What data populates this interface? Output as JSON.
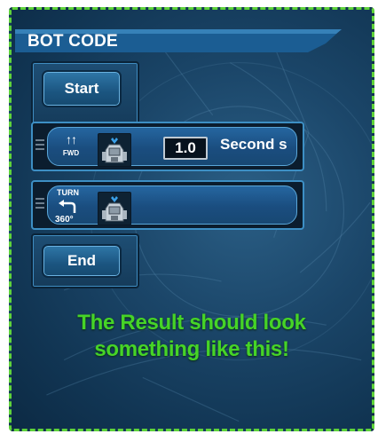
{
  "panel": {
    "title": "BOT CODE"
  },
  "blocks": {
    "start_label": "Start",
    "end_label": "End"
  },
  "commands": [
    {
      "icon": "forward-arrows-icon",
      "icon_label": "FWD",
      "value": "1.0",
      "unit": "Second s"
    },
    {
      "icon": "turn-left-icon",
      "icon_label": "TURN",
      "angle": "360°"
    }
  ],
  "caption": {
    "line1": "The Result should look",
    "line2": "something like this!"
  },
  "colors": {
    "frame_border": "#5fd33a",
    "caption_text": "#46d427",
    "header_bar": "#1b5d93",
    "background": "#1b4669"
  }
}
